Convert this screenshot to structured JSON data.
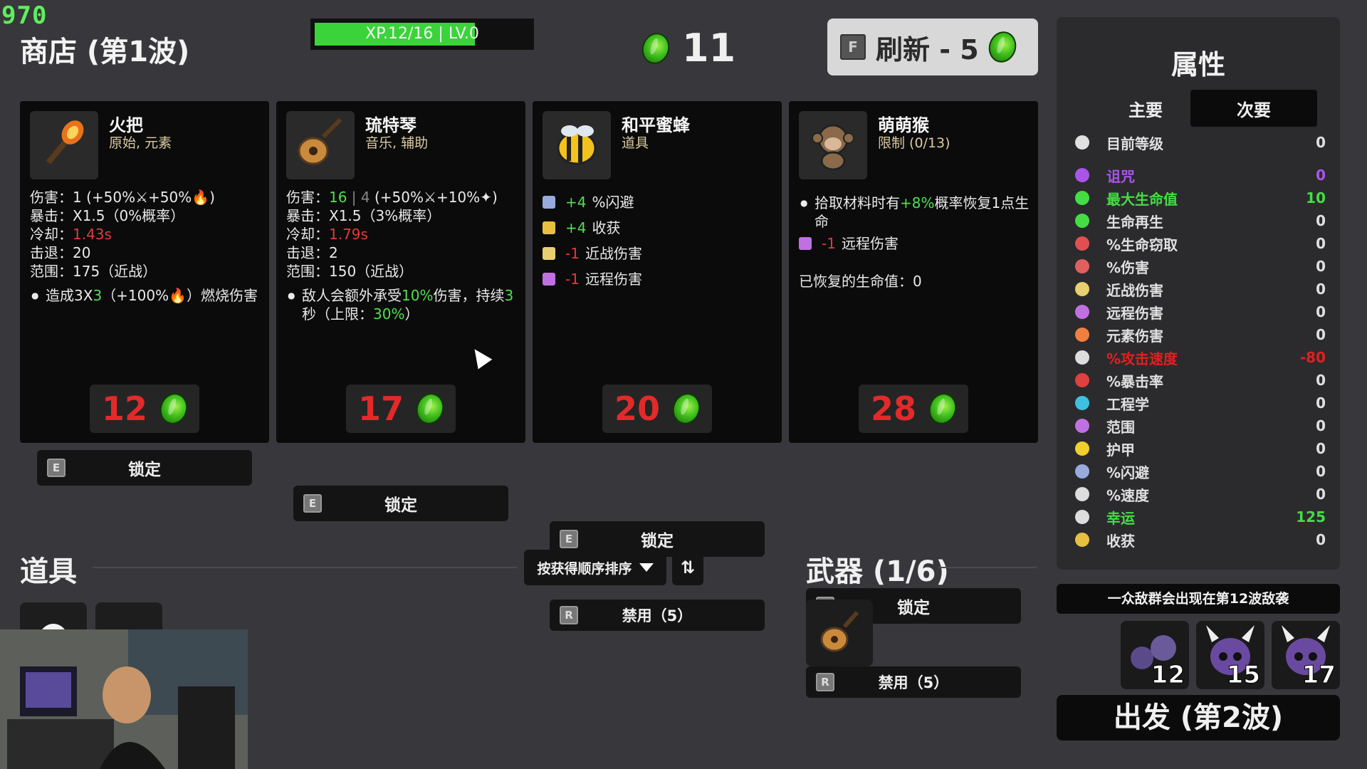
{
  "hud": {
    "fps": "970",
    "shop_title": "商店 (第1波)",
    "xp_text": "XP.12/16 | LV.0",
    "xp_progress": 0.75,
    "materials": "11",
    "refresh_key": "F",
    "refresh_label": "刷新 - 5"
  },
  "cards": [
    {
      "name": "火把",
      "tags": "原始, 元素",
      "icon": "torch-icon",
      "lines": [
        {
          "k": "伤害：",
          "parts": [
            {
              "t": "1",
              "c": ""
            },
            {
              "t": " (+50%",
              "c": ""
            },
            {
              "t": "⚔",
              "c": ""
            },
            {
              "t": "+50%",
              "c": ""
            },
            {
              "t": "🔥",
              "c": ""
            },
            {
              "t": ")",
              "c": ""
            }
          ]
        },
        {
          "k": "暴击：",
          "parts": [
            {
              "t": "X1.5（0%概率）",
              "c": ""
            }
          ]
        },
        {
          "k": "冷却：",
          "parts": [
            {
              "t": "1.43s",
              "c": "red"
            }
          ]
        },
        {
          "k": "击退：",
          "parts": [
            {
              "t": "20",
              "c": ""
            }
          ]
        },
        {
          "k": "范围：",
          "parts": [
            {
              "t": "175（近战）",
              "c": ""
            }
          ]
        }
      ],
      "bullet": [
        {
          "t": "造成3X",
          "c": ""
        },
        {
          "t": "3",
          "c": "green"
        },
        {
          "t": "（+100%",
          "c": ""
        },
        {
          "t": "🔥",
          "c": ""
        },
        {
          "t": "）燃烧伤害",
          "c": ""
        }
      ],
      "price": "12",
      "lock_key": "E",
      "lock_label": "锁定"
    },
    {
      "name": "琉特琴",
      "tags": "音乐, 辅助",
      "icon": "lute-icon",
      "lines": [
        {
          "k": "伤害：",
          "parts": [
            {
              "t": "16",
              "c": "green"
            },
            {
              "t": " | ",
              "c": "grey"
            },
            {
              "t": "4",
              "c": "grey"
            },
            {
              "t": " (+50%",
              "c": ""
            },
            {
              "t": "⚔",
              "c": ""
            },
            {
              "t": "+10%",
              "c": ""
            },
            {
              "t": "✦",
              "c": ""
            },
            {
              "t": ")",
              "c": ""
            }
          ]
        },
        {
          "k": "暴击：",
          "parts": [
            {
              "t": "X1.5（3%概率）",
              "c": ""
            }
          ]
        },
        {
          "k": "冷却：",
          "parts": [
            {
              "t": "1.79s",
              "c": "red"
            }
          ]
        },
        {
          "k": "击退：",
          "parts": [
            {
              "t": "2",
              "c": ""
            }
          ]
        },
        {
          "k": "范围：",
          "parts": [
            {
              "t": "150（近战）",
              "c": ""
            }
          ]
        }
      ],
      "bullet": [
        {
          "t": "敌人会额外承受",
          "c": ""
        },
        {
          "t": "10%",
          "c": "green"
        },
        {
          "t": "伤害，持续",
          "c": ""
        },
        {
          "t": "3",
          "c": "green"
        },
        {
          "t": "秒（上限：",
          "c": ""
        },
        {
          "t": "30%",
          "c": "green"
        },
        {
          "t": "）",
          "c": ""
        }
      ],
      "price": "17",
      "lock_key": "E",
      "lock_label": "锁定"
    },
    {
      "name": "和平蜜蜂",
      "tags": "道具",
      "icon": "bee-icon",
      "stats": [
        {
          "icon": "dodge-icon",
          "color": "#9ad",
          "val": "+4",
          "vc": "green",
          "label": " %闪避"
        },
        {
          "icon": "harvest-icon",
          "color": "#e8c040",
          "val": "+4",
          "vc": "green",
          "label": " 收获"
        },
        {
          "icon": "melee-icon",
          "color": "#e8d070",
          "val": "-1",
          "vc": "red",
          "label": " 近战伤害"
        },
        {
          "icon": "ranged-icon",
          "color": "#c070e0",
          "val": "-1",
          "vc": "red",
          "label": " 远程伤害"
        }
      ],
      "price": "20",
      "lock_key": "E",
      "lock_label": "锁定",
      "ban_key": "R",
      "ban_label": "禁用（5）"
    },
    {
      "name": "萌萌猴",
      "tags": "限制 (0/13)",
      "icon": "monkey-icon",
      "bullet": [
        {
          "t": "拾取材料时有",
          "c": ""
        },
        {
          "t": "+8%",
          "c": "green"
        },
        {
          "t": "概率恢复1点生命",
          "c": ""
        }
      ],
      "stats": [
        {
          "icon": "ranged-icon",
          "color": "#c070e0",
          "val": "-1",
          "vc": "red",
          "label": " 远程伤害"
        }
      ],
      "extra": "已恢复的生命值：0",
      "price": "28",
      "lock_key": "E",
      "lock_label": "锁定",
      "ban_key": "R",
      "ban_label": "禁用（5）"
    }
  ],
  "items_section": {
    "title": "道具",
    "sort_label": "按获得顺序排序"
  },
  "weapons_section": {
    "title": "武器 (1/6)"
  },
  "stats_panel": {
    "title": "属性",
    "tab_primary": "主要",
    "tab_secondary": "次要",
    "rows": [
      {
        "icon": "level-icon",
        "label": "目前等级",
        "value": "0",
        "color": "#e0e0e0",
        "ic": "#e0e0e0"
      },
      {
        "icon": "curse-icon",
        "label": "诅咒",
        "value": "0",
        "color": "#a855e8",
        "ic": "#a855e8"
      },
      {
        "icon": "heart-icon",
        "label": "最大生命值",
        "value": "10",
        "color": "#44dd44",
        "ic": "#44dd44"
      },
      {
        "icon": "regen-icon",
        "label": "生命再生",
        "value": "0",
        "color": "#e0e0e0",
        "ic": "#44dd44"
      },
      {
        "icon": "lifesteal-icon",
        "label": "%生命窃取",
        "value": "0",
        "color": "#e0e0e0",
        "ic": "#e05050"
      },
      {
        "icon": "damage-icon",
        "label": "%伤害",
        "value": "0",
        "color": "#e0e0e0",
        "ic": "#e06060"
      },
      {
        "icon": "melee-icon",
        "label": "近战伤害",
        "value": "0",
        "color": "#e0e0e0",
        "ic": "#e8d070"
      },
      {
        "icon": "ranged-icon",
        "label": "远程伤害",
        "value": "0",
        "color": "#e0e0e0",
        "ic": "#c070e0"
      },
      {
        "icon": "elemental-icon",
        "label": "元素伤害",
        "value": "0",
        "color": "#e0e0e0",
        "ic": "#f08040"
      },
      {
        "icon": "hourglass-icon",
        "label": "%攻击速度",
        "value": "-80",
        "color": "#e02020",
        "ic": "#ddd"
      },
      {
        "icon": "crit-icon",
        "label": "%暴击率",
        "value": "0",
        "color": "#e0e0e0",
        "ic": "#e04040"
      },
      {
        "icon": "engineering-icon",
        "label": "工程学",
        "value": "0",
        "color": "#e0e0e0",
        "ic": "#40c0e0"
      },
      {
        "icon": "range-icon",
        "label": "范围",
        "value": "0",
        "color": "#e0e0e0",
        "ic": "#c070e0"
      },
      {
        "icon": "armor-icon",
        "label": "护甲",
        "value": "0",
        "color": "#e0e0e0",
        "ic": "#f0d030"
      },
      {
        "icon": "dodge-icon",
        "label": "%闪避",
        "value": "0",
        "color": "#e0e0e0",
        "ic": "#9ad"
      },
      {
        "icon": "speed-icon",
        "label": "%速度",
        "value": "0",
        "color": "#e0e0e0",
        "ic": "#ddd"
      },
      {
        "icon": "luck-icon",
        "label": "幸运",
        "value": "125",
        "color": "#44dd44",
        "ic": "#ddd"
      },
      {
        "icon": "harvest-icon",
        "label": "收获",
        "value": "0",
        "color": "#e0e0e0",
        "ic": "#e8c040"
      }
    ]
  },
  "horde_notice": "一众敌群会出现在第12波敌袭",
  "enemies": [
    {
      "icon": "enemy-blob-icon",
      "wave": "12"
    },
    {
      "icon": "enemy-horned-skull-icon",
      "wave": "15"
    },
    {
      "icon": "enemy-horned-skull-icon",
      "wave": "17"
    }
  ],
  "go_button": "出发 (第2波)"
}
